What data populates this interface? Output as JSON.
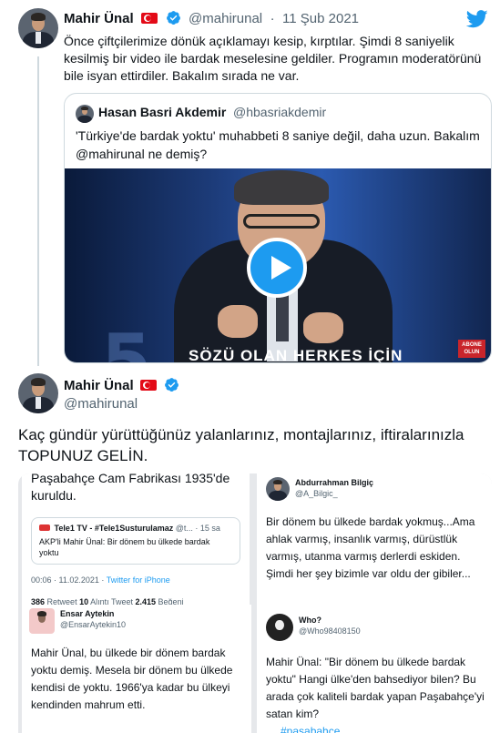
{
  "main_tweet": {
    "author_name": "Mahir Ünal",
    "handle": "@mahirunal",
    "separator": "·",
    "date": "11 Şub 2021",
    "text": "Önce çiftçilerimize dönük açıklamayı kesip, kırptılar. Şimdi 8 saniyelik kesilmiş bir video ile bardak meselesine geldiler. Programın moderatörünü bile isyan ettirdiler. Bakalım sırada ne var.",
    "quoted": {
      "author_name": "Hasan Basri Akdemir",
      "handle": "@hbasriakdemir",
      "text": "'Türkiye'de bardak yoktu' muhabbeti 8 saniye değil, daha uzun. Bakalım @mahirunal ne demiş?",
      "video_caption": "SÖZÜ OLAN HERKES İÇİN",
      "video_background_text": "5",
      "video_badge": "ABONE OLUN"
    }
  },
  "reply_tweet": {
    "author_name": "Mahir Ünal",
    "handle": "@mahirunal",
    "text": "Kaç gündür yürüttüğünüz yalanlarınız, montajlarınız, iftiralarınızla TOPUNUZ GELİN.",
    "collage": {
      "panel_a": {
        "text": "Paşabahçe Cam Fabrikası 1935'de kuruldu.",
        "card_source": "Tele1 TV - #Tele1Susturulamaz",
        "card_handle": "@t...",
        "card_separator": "·",
        "card_time": "15 sa",
        "card_text": "AKP'li Mahir Ünal: Bir dönem bu ülkede bardak yoktu",
        "timestamp": "00:06 · 11.02.2021 ·",
        "client": "Twitter for iPhone",
        "retweets": "386",
        "retweets_label": "Retweet",
        "quotes": "10",
        "quotes_label": "Alıntı Tweet",
        "likes": "2.415",
        "likes_label": "Beğeni"
      },
      "panel_b": {
        "author_name": "Abdurrahman Bilgiç",
        "handle": "@A_Bilgic_",
        "text": "Bir dönem bu ülkede bardak yokmuş...Ama ahlak varmış, insanlık varmış, dürüstlük varmış, utanma varmış derlerdi eskiden. Şimdi her şey bizimle var oldu der gibiler..."
      },
      "panel_c": {
        "author_name": "Ensar Aytekin",
        "handle": "@EnsarAytekin10",
        "text": "Mahir Ünal, bu ülkede bir dönem bardak yoktu demiş. Mesela bir dönem bu ülkede kendisi de yoktu. 1966'ya kadar bu ülkeyi kendinden mahrum etti."
      },
      "panel_d": {
        "author_name": "Who?",
        "handle": "@Who98408150",
        "text": "Mahir Ünal: \"Bir dönem bu ülkede bardak yoktu\" Hangi ülke'den bahsediyor bilen? Bu arada çok kaliteli bardak yapan Paşabahçe'yi satan kim?",
        "hashtag": "#pasabahce"
      }
    }
  },
  "colors": {
    "accent": "#1d9bf0",
    "flag_red": "#e30a17",
    "secondary_text": "#536471"
  },
  "icons": {
    "twitter": "twitter-bird-icon",
    "verified": "verified-badge-icon",
    "flag": "turkey-flag-icon",
    "play": "play-icon"
  }
}
